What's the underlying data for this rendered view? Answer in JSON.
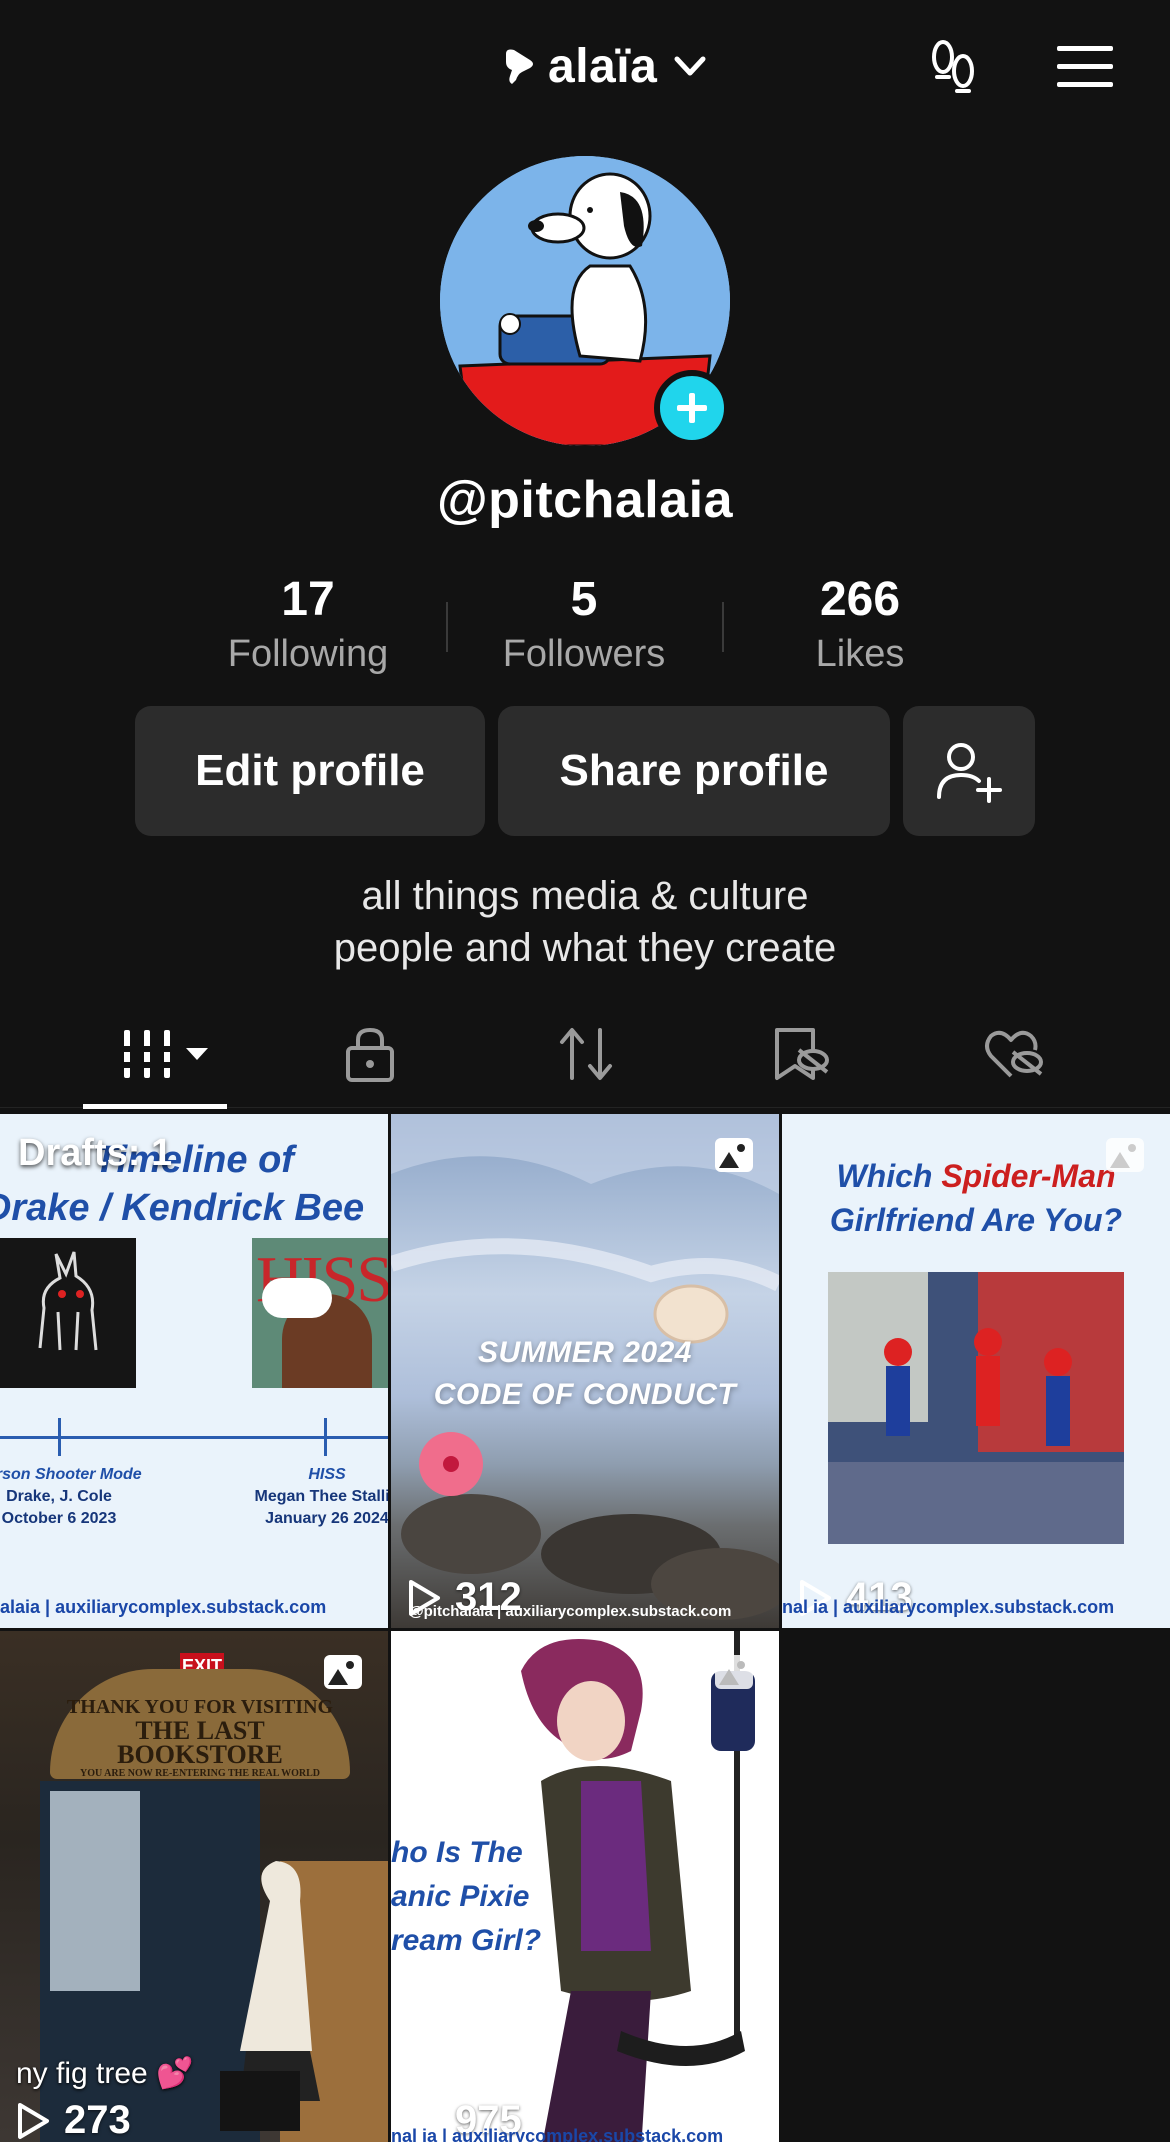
{
  "header": {
    "account_name": "alaïa",
    "icons": [
      "pin-mark-icon",
      "chevron-down-icon",
      "footprints-icon",
      "menu-icon"
    ]
  },
  "profile": {
    "handle": "@pitchalaia",
    "stats": [
      {
        "value": "17",
        "label": "Following"
      },
      {
        "value": "5",
        "label": "Followers"
      },
      {
        "value": "266",
        "label": "Likes"
      }
    ],
    "buttons": {
      "edit": "Edit profile",
      "share": "Share profile"
    },
    "bio_line1": "all things media & culture",
    "bio_line2": "people and what they create"
  },
  "tabs": [
    "videos-grid-icon",
    "private-lock-icon",
    "repost-icon",
    "saved-hidden-icon",
    "liked-hidden-icon"
  ],
  "posts": [
    {
      "drafts": "Drafts: 1",
      "title_line1": "Timeline of",
      "title_line2": "Drake / Kendrick Bee",
      "cover2_text": "HISS",
      "col1_title": "Person Shooter Mode",
      "col1_artist": "Drake, J. Cole",
      "col1_date": "October 6 2023",
      "col2_title": "HISS",
      "col2_artist": "Megan Thee Stallio",
      "col2_date": "January 26 2024",
      "credit": "alaia | auxiliarycomplex.substack.com"
    },
    {
      "line1": "SUMMER 2024",
      "line2": "CODE OF CONDUCT",
      "views": "312",
      "credit": "@pitchalaia | auxiliarycomplex.substack.com"
    },
    {
      "title_a": "Which ",
      "title_b": "Spider-Man",
      "title_c": "Girlfriend Are You?",
      "views": "413",
      "credit": "nal ia | auxiliarycomplex.substack.com"
    },
    {
      "sign_line1": "THANK YOU FOR VISITING",
      "sign_line2": "THE LAST BOOKSTORE",
      "sign_line3": "YOU ARE NOW RE-ENTERING THE REAL WORLD",
      "exit": "EXIT",
      "caption": "ny fig tree 💕",
      "views": "273"
    },
    {
      "title_line1": "ho Is The",
      "title_line2": "anic Pixie",
      "title_line3": "ream Girl?",
      "views": "975",
      "credit": "nal ia | auxiliarycomplex.substack.com"
    }
  ],
  "colors": {
    "accent": "#20d5ec",
    "bg": "#121212",
    "button": "#2c2c2c"
  }
}
